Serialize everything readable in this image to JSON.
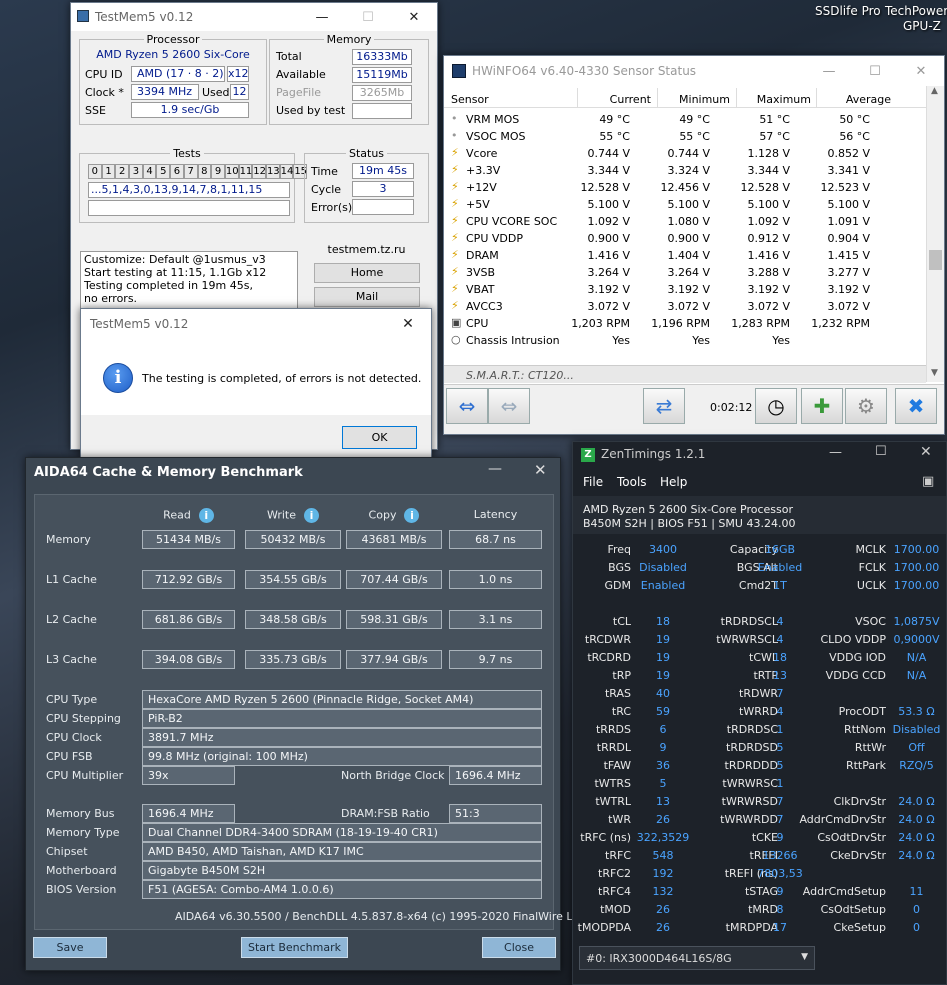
{
  "desktop": {
    "icon1": "SSDlife Pro",
    "icon2": "TechPowerU",
    "icon2b": "GPU-Z"
  },
  "testmem": {
    "title": "TestMem5 v0.12",
    "processor": {
      "group": "Processor",
      "name": "AMD Ryzen 5 2600 Six-Core",
      "cpuid_label": "CPU ID",
      "cpuid": "AMD  (17 · 8 · 2)",
      "threads": "x12",
      "clock_label": "Clock *",
      "clock": "3394 MHz",
      "used_label": "Used",
      "used": "12",
      "sse_label": "SSE",
      "sse": "1.9 sec/Gb"
    },
    "memory": {
      "group": "Memory",
      "total_label": "Total",
      "total": "16333Mb",
      "avail_label": "Available",
      "avail": "15119Mb",
      "pagefile_label": "PageFile",
      "pagefile": "3265Mb",
      "usedbytest_label": "Used by test",
      "usedbytest": ""
    },
    "tests": {
      "group": "Tests",
      "cells": [
        "0",
        "1",
        "2",
        "3",
        "4",
        "5",
        "6",
        "7",
        "8",
        "9",
        "10",
        "11",
        "12",
        "13",
        "14",
        "15"
      ],
      "sequence": "...5,1,4,3,0,13,9,14,7,8,1,11,15"
    },
    "status": {
      "group": "Status",
      "time_label": "Time",
      "time": "19m 45s",
      "cycle_label": "Cycle",
      "cycle": "3",
      "errors_label": "Error(s)",
      "errors": ""
    },
    "log": [
      "Customize: Default @1usmus_v3",
      "Start testing at 11:15, 1.1Gb x12",
      "Testing completed in 19m 45s,",
      "no errors."
    ],
    "site": "testmem.tz.ru",
    "home": "Home",
    "mail": "Mail"
  },
  "dialog": {
    "title": "TestMem5 v0.12",
    "message": "The testing is completed, of errors is not detected.",
    "ok": "OK"
  },
  "hwinfo": {
    "title": "HWiNFO64 v6.40-4330 Sensor Status",
    "headers": [
      "Sensor",
      "Current",
      "Minimum",
      "Maximum",
      "Average"
    ],
    "rows": [
      {
        "icon": "thermometer-icon",
        "name": "VRM MOS",
        "cur": "49 °C",
        "min": "49 °C",
        "max": "51 °C",
        "avg": "50 °C"
      },
      {
        "icon": "thermometer-icon",
        "name": "VSOC MOS",
        "cur": "55 °C",
        "min": "55 °C",
        "max": "57 °C",
        "avg": "56 °C"
      },
      {
        "icon": "voltage-icon",
        "name": "Vcore",
        "cur": "0.744 V",
        "min": "0.744 V",
        "max": "1.128 V",
        "avg": "0.852 V"
      },
      {
        "icon": "voltage-icon",
        "name": "+3.3V",
        "cur": "3.344 V",
        "min": "3.324 V",
        "max": "3.344 V",
        "avg": "3.341 V"
      },
      {
        "icon": "voltage-icon",
        "name": "+12V",
        "cur": "12.528 V",
        "min": "12.456 V",
        "max": "12.528 V",
        "avg": "12.523 V"
      },
      {
        "icon": "voltage-icon",
        "name": "+5V",
        "cur": "5.100 V",
        "min": "5.100 V",
        "max": "5.100 V",
        "avg": "5.100 V"
      },
      {
        "icon": "voltage-icon",
        "name": "CPU VCORE SOC",
        "cur": "1.092 V",
        "min": "1.080 V",
        "max": "1.092 V",
        "avg": "1.091 V"
      },
      {
        "icon": "voltage-icon",
        "name": "CPU VDDP",
        "cur": "0.900 V",
        "min": "0.900 V",
        "max": "0.912 V",
        "avg": "0.904 V"
      },
      {
        "icon": "voltage-icon",
        "name": "DRAM",
        "cur": "1.416 V",
        "min": "1.404 V",
        "max": "1.416 V",
        "avg": "1.415 V"
      },
      {
        "icon": "voltage-icon",
        "name": "3VSB",
        "cur": "3.264 V",
        "min": "3.264 V",
        "max": "3.288 V",
        "avg": "3.277 V"
      },
      {
        "icon": "voltage-icon",
        "name": "VBAT",
        "cur": "3.192 V",
        "min": "3.192 V",
        "max": "3.192 V",
        "avg": "3.192 V"
      },
      {
        "icon": "voltage-icon",
        "name": "AVCC3",
        "cur": "3.072 V",
        "min": "3.072 V",
        "max": "3.072 V",
        "avg": "3.072 V"
      },
      {
        "icon": "fan-icon",
        "name": "CPU",
        "cur": "1,203 RPM",
        "min": "1,196 RPM",
        "max": "1,283 RPM",
        "avg": "1,232 RPM"
      },
      {
        "icon": "intrusion-icon",
        "name": "Chassis Intrusion",
        "cur": "Yes",
        "min": "Yes",
        "max": "Yes",
        "avg": ""
      }
    ],
    "group_row": "S.M.A.R.T.: CT120...",
    "timer": "0:02:12"
  },
  "aida": {
    "title": "AIDA64 Cache & Memory Benchmark",
    "cols": [
      "Read",
      "Write",
      "Copy",
      "Latency"
    ],
    "bench": [
      {
        "label": "Memory",
        "read": "51434 MB/s",
        "write": "50432 MB/s",
        "copy": "43681 MB/s",
        "lat": "68.7 ns"
      },
      {
        "label": "L1 Cache",
        "read": "712.92 GB/s",
        "write": "354.55 GB/s",
        "copy": "707.44 GB/s",
        "lat": "1.0 ns"
      },
      {
        "label": "L2 Cache",
        "read": "681.86 GB/s",
        "write": "348.58 GB/s",
        "copy": "598.31 GB/s",
        "lat": "3.1 ns"
      },
      {
        "label": "L3 Cache",
        "read": "394.08 GB/s",
        "write": "335.73 GB/s",
        "copy": "377.94 GB/s",
        "lat": "9.7 ns"
      }
    ],
    "cpu_type_label": "CPU Type",
    "cpu_type": "HexaCore AMD Ryzen 5 2600  (Pinnacle Ridge, Socket AM4)",
    "cpu_step_label": "CPU Stepping",
    "cpu_step": "PiR-B2",
    "cpu_clock_label": "CPU Clock",
    "cpu_clock": "3891.7 MHz",
    "cpu_fsb_label": "CPU FSB",
    "cpu_fsb": "99.8 MHz  (original: 100 MHz)",
    "cpu_mult_label": "CPU Multiplier",
    "cpu_mult": "39x",
    "nb_label": "North Bridge Clock",
    "nb": "1696.4 MHz",
    "membus_label": "Memory Bus",
    "membus": "1696.4 MHz",
    "ratio_label": "DRAM:FSB Ratio",
    "ratio": "51:3",
    "memtype_label": "Memory Type",
    "memtype": "Dual Channel DDR4-3400 SDRAM  (18-19-19-40 CR1)",
    "chipset_label": "Chipset",
    "chipset": "AMD B450, AMD Taishan, AMD K17 IMC",
    "mobo_label": "Motherboard",
    "mobo": "Gigabyte B450M S2H",
    "bios_label": "BIOS Version",
    "bios": "F51  (AGESA: Combo-AM4 1.0.0.6)",
    "footer": "AIDA64 v6.30.5500 / BenchDLL 4.5.837.8-x64  (c) 1995-2020 FinalWire Ltd.",
    "save": "Save",
    "start": "Start Benchmark",
    "close": "Close"
  },
  "zen": {
    "title": "ZenTimings 1.2.1",
    "menu": [
      "File",
      "Tools",
      "Help"
    ],
    "cpu": "AMD Ryzen 5 2600 Six-Core Processor",
    "board": "B450M S2H | BIOS F51 | SMU 43.24.00",
    "top": [
      [
        "Freq",
        "3400",
        "Capacity",
        "16GB",
        "MCLK",
        "1700.00"
      ],
      [
        "BGS",
        "Disabled",
        "BGS Alt",
        "Enabled",
        "FCLK",
        "1700.00"
      ],
      [
        "GDM",
        "Enabled",
        "Cmd2T",
        "1T",
        "UCLK",
        "1700.00"
      ]
    ],
    "timings": [
      [
        "tCL",
        "18",
        "tRDRDSCL",
        "4",
        "VSOC",
        "1,0875V"
      ],
      [
        "tRCDWR",
        "19",
        "tWRWRSCL",
        "4",
        "CLDO VDDP",
        "0,9000V"
      ],
      [
        "tRCDRD",
        "19",
        "tCWL",
        "18",
        "VDDG IOD",
        "N/A"
      ],
      [
        "tRP",
        "19",
        "tRTP",
        "13",
        "VDDG CCD",
        "N/A"
      ],
      [
        "tRAS",
        "40",
        "tRDWR",
        "7",
        "",
        ""
      ],
      [
        "tRC",
        "59",
        "tWRRD",
        "4",
        "ProcODT",
        "53.3 Ω"
      ],
      [
        "tRRDS",
        "6",
        "tRDRDSC",
        "1",
        "RttNom",
        "Disabled"
      ],
      [
        "tRRDL",
        "9",
        "tRDRDSD",
        "5",
        "RttWr",
        "Off"
      ],
      [
        "tFAW",
        "36",
        "tRDRDDD",
        "5",
        "RttPark",
        "RZQ/5"
      ],
      [
        "tWTRS",
        "5",
        "tWRWRSC",
        "1",
        "",
        ""
      ],
      [
        "tWTRL",
        "13",
        "tWRWRSD",
        "7",
        "ClkDrvStr",
        "24.0 Ω"
      ],
      [
        "tWR",
        "26",
        "tWRWRDD",
        "7",
        "AddrCmdDrvStr",
        "24.0 Ω"
      ],
      [
        "tRFC (ns)",
        "322,3529",
        "tCKE",
        "9",
        "CsOdtDrvStr",
        "24.0 Ω"
      ],
      [
        "tRFC",
        "548",
        "tREFI",
        "13266",
        "CkeDrvStr",
        "24.0 Ω"
      ],
      [
        "tRFC2",
        "192",
        "tREFI (ns)",
        "7803,53",
        "",
        ""
      ],
      [
        "tRFC4",
        "132",
        "tSTAG",
        "9",
        "AddrCmdSetup",
        "11"
      ],
      [
        "tMOD",
        "26",
        "tMRD",
        "8",
        "CsOdtSetup",
        "0"
      ],
      [
        "tMODPDA",
        "26",
        "tMRDPDA",
        "17",
        "CkeSetup",
        "0"
      ]
    ],
    "dimm": "#0: IRX3000D464L16S/8G"
  }
}
